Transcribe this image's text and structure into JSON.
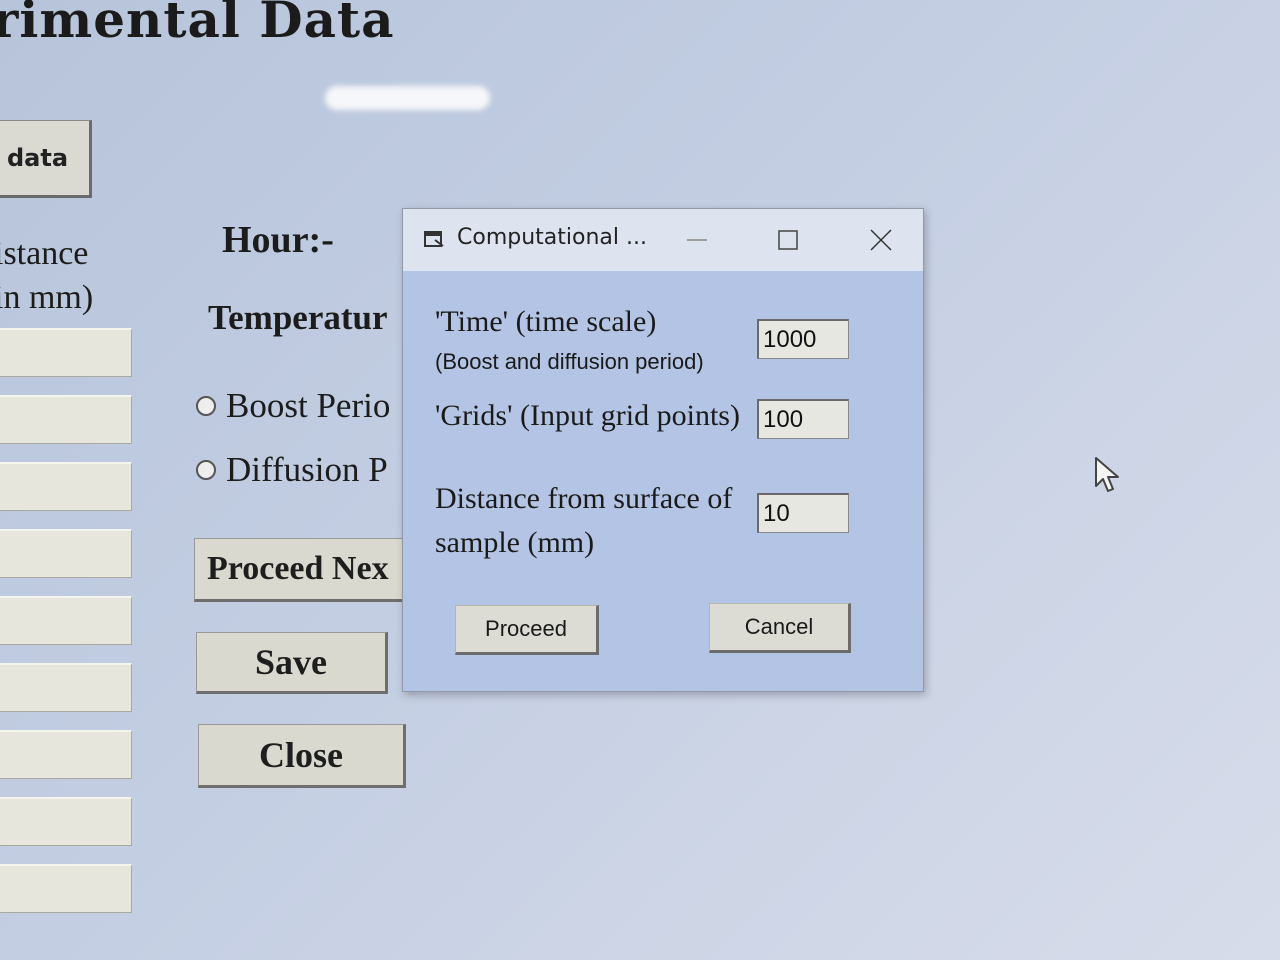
{
  "background": {
    "title": "rimental Data",
    "data_button": "data",
    "distance_label_line1": "istance",
    "distance_label_line2": "in mm)",
    "hour_label": "Hour:-",
    "temperature_label": "Temperatur",
    "radio_boost": "Boost Perio",
    "radio_diffusion": "Diffusion P",
    "proceed_next_button": "Proceed Nex",
    "save_button": "Save",
    "close_button": "Close"
  },
  "dialog": {
    "title": "Computational ...",
    "time_label": "'Time' (time scale)",
    "time_sublabel": "(Boost and diffusion period)",
    "time_value": "1000",
    "grids_label": "'Grids' (Input grid points)",
    "grids_value": "100",
    "distance_label": "Distance from surface of sample (mm)",
    "distance_value": "10",
    "proceed_button": "Proceed",
    "cancel_button": "Cancel"
  },
  "icons": [
    "app-icon",
    "minimize-icon",
    "maximize-icon",
    "close-icon",
    "mouse-cursor-icon"
  ]
}
